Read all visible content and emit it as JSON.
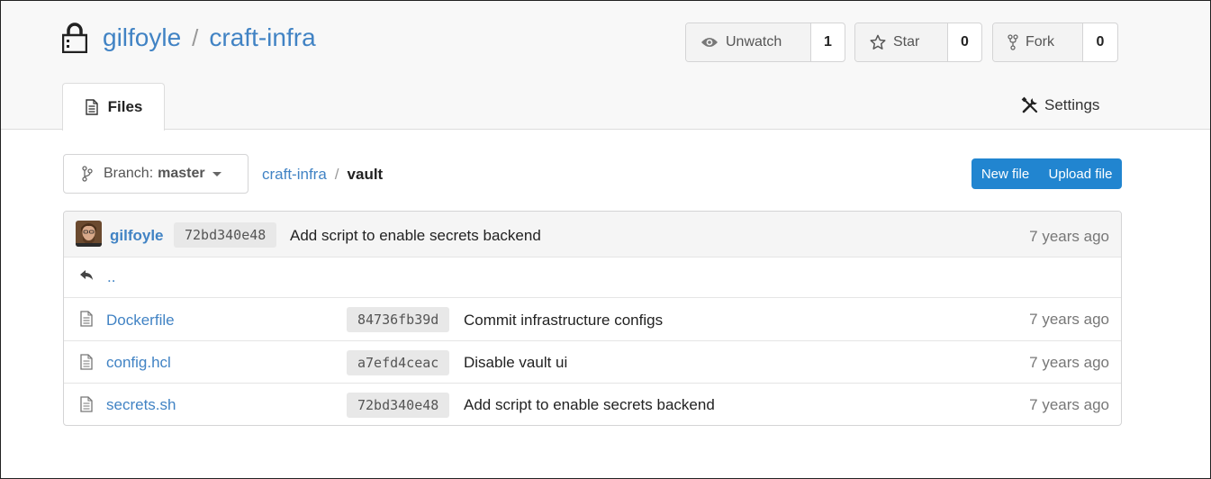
{
  "repo": {
    "owner": "gilfoyle",
    "separator": "/",
    "name": "craft-infra"
  },
  "actions": {
    "watch": {
      "label": "Unwatch",
      "count": "1",
      "icon": "eye-icon"
    },
    "star": {
      "label": "Star",
      "count": "0",
      "icon": "star-icon"
    },
    "fork": {
      "label": "Fork",
      "count": "0",
      "icon": "fork-icon"
    }
  },
  "tabs": {
    "files": {
      "label": "Files",
      "icon": "file-text-icon",
      "active": true
    },
    "settings": {
      "label": "Settings",
      "icon": "tools-icon"
    }
  },
  "toolbar": {
    "branch_prefix": "Branch:",
    "branch_name": "master",
    "path": [
      "craft-infra",
      "vault"
    ],
    "path_separator": "/",
    "new_file": "New file",
    "upload_file": "Upload file"
  },
  "latest_commit": {
    "author": "gilfoyle",
    "sha": "72bd340e48",
    "message": "Add script to enable secrets backend",
    "time": "7 years ago"
  },
  "parent_link": "..",
  "files": [
    {
      "name": "Dockerfile",
      "sha": "84736fb39d",
      "message": "Commit infrastructure configs",
      "time": "7 years ago"
    },
    {
      "name": "config.hcl",
      "sha": "a7efd4ceac",
      "message": "Disable vault ui",
      "time": "7 years ago"
    },
    {
      "name": "secrets.sh",
      "sha": "72bd340e48",
      "message": "Add script to enable secrets backend",
      "time": "7 years ago"
    }
  ],
  "colors": {
    "link": "#4183c4",
    "primary_button": "#2185d0",
    "header_bg": "#f8f8f8"
  }
}
